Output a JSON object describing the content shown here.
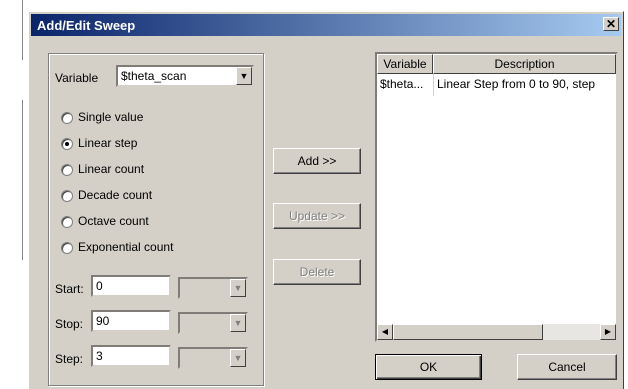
{
  "window": {
    "title": "Add/Edit Sweep",
    "close_glyph": "✕"
  },
  "variable": {
    "label": "Variable",
    "value": "$theta_scan"
  },
  "modes": [
    {
      "label": "Single value",
      "selected": false
    },
    {
      "label": "Linear step",
      "selected": true
    },
    {
      "label": "Linear count",
      "selected": false
    },
    {
      "label": "Decade count",
      "selected": false
    },
    {
      "label": "Octave count",
      "selected": false
    },
    {
      "label": "Exponential count",
      "selected": false
    }
  ],
  "params": {
    "start": {
      "label": "Start:",
      "value": "0"
    },
    "stop": {
      "label": "Stop:",
      "value": "90"
    },
    "step": {
      "label": "Step:",
      "value": "3"
    }
  },
  "buttons": {
    "add": "Add >>",
    "update": "Update >>",
    "delete": "Delete",
    "ok": "OK",
    "cancel": "Cancel"
  },
  "table": {
    "headers": [
      "Variable",
      "Description"
    ],
    "rows": [
      {
        "variable": "$theta...",
        "description": "Linear Step from 0 to 90, step"
      }
    ]
  },
  "icons": {
    "dropdown": "▼",
    "scroll_left": "◀",
    "scroll_right": "▶"
  },
  "colors": {
    "titlebar_start": "#0a246a",
    "titlebar_end": "#a6caf0",
    "face": "#d4d0c8"
  }
}
